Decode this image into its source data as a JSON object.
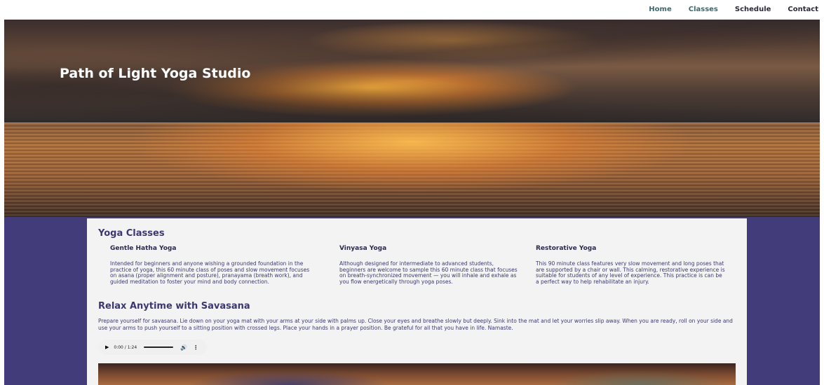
{
  "nav": {
    "items": [
      {
        "label": "Home"
      },
      {
        "label": "Classes"
      },
      {
        "label": "Schedule"
      },
      {
        "label": "Contact"
      }
    ]
  },
  "hero": {
    "title": "Path of Light Yoga Studio"
  },
  "classes": {
    "title": "Yoga Classes",
    "items": [
      {
        "name": "Gentle Hatha Yoga",
        "description": "Intended for beginners and anyone wishing a grounded foundation in the practice of yoga, this 60 minute class of poses and slow movement focuses on asana (proper alignment and posture), pranayama (breath work), and guided meditation to foster your mind and body connection."
      },
      {
        "name": "Vinyasa Yoga",
        "description": "Although designed for intermediate to advanced students, beginners are welcome to sample this 60 minute class that focuses on breath-synchronized movement — you will inhale and exhale as you flow energetically through yoga poses."
      },
      {
        "name": "Restorative Yoga",
        "description": "This 90 minute class features very slow movement and long poses that are supported by a chair or wall. This calming, restorative experience is suitable for students of any level of experience. This practice is can be a perfect way to help rehabilitate an injury."
      }
    ]
  },
  "savasana": {
    "title": "Relax Anytime with Savasana",
    "text": "Prepare yourself for savasana. Lie down on your yoga mat with your arms at your side with palms up. Close your eyes and breathe slowly but deeply. Sink into the mat and let your worries slip away. When you are ready, roll on your side and use your arms to push yourself to a sitting position with crossed legs. Place your hands in a prayer position. Be grateful for all that you have in life. Namaste."
  },
  "audio": {
    "play_icon": "play-icon",
    "time": "0:00 / 1:24",
    "volume_icon": "volume-icon",
    "more_icon": "more-options-icon",
    "progress": 0
  },
  "colors": {
    "accent": "#423c7a",
    "heading": "#3b3870",
    "nav_active": "#3c6a6e"
  }
}
